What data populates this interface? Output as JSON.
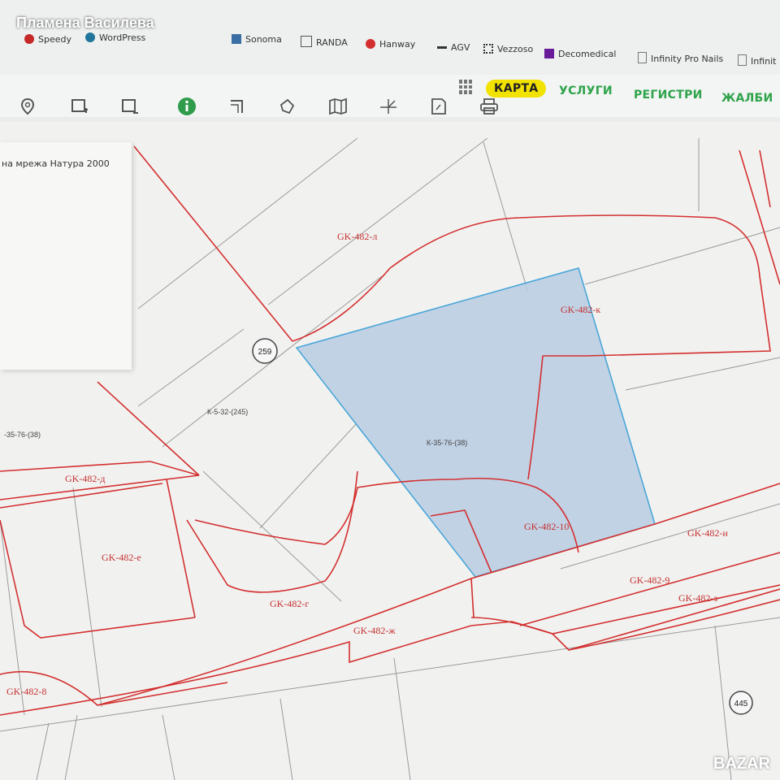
{
  "owner_name": "Пламена Василева",
  "bookmarks": [
    {
      "label": "Speedy",
      "icon": "speedy-icon",
      "color": "#c62828"
    },
    {
      "label": "WordPress",
      "icon": "wordpress-icon",
      "color": "#21759b"
    },
    {
      "label": "Sonoma",
      "icon": "sonoma-icon",
      "color": "#3a6ea5"
    },
    {
      "label": "RANDA",
      "icon": "randa-icon",
      "color": "#555555"
    },
    {
      "label": "Hanway",
      "icon": "hanway-icon",
      "color": "#d32f2f"
    },
    {
      "label": "AGV",
      "icon": "agv-icon",
      "color": "#333333"
    },
    {
      "label": "Vezzoso",
      "icon": "vezzoso-icon",
      "color": "#333333"
    },
    {
      "label": "Decomedical",
      "icon": "decomedical-icon",
      "color": "#6a1b9a"
    },
    {
      "label": "Infinity Pro Nails",
      "icon": "page-icon",
      "color": "#777777"
    },
    {
      "label": "Infinit",
      "icon": "page-icon",
      "color": "#777777"
    }
  ],
  "nav": {
    "apps_icon": "grid-icon",
    "items": [
      {
        "label": "КАРТА",
        "active": true
      },
      {
        "label": "УСЛУГИ",
        "active": false
      },
      {
        "label": "РЕГИСТРИ",
        "active": false
      },
      {
        "label": "ЖАЛБИ",
        "active": false
      }
    ]
  },
  "toolbar": [
    {
      "icon": "location-pin-icon"
    },
    {
      "icon": "draw-rectangle-icon"
    },
    {
      "icon": "select-rectangle-icon"
    },
    {
      "icon": "info-icon",
      "active": true
    },
    {
      "icon": "measure-line-icon"
    },
    {
      "icon": "polygon-icon"
    },
    {
      "icon": "map-layers-icon"
    },
    {
      "icon": "measure-angle-icon"
    },
    {
      "icon": "document-icon"
    },
    {
      "icon": "print-icon"
    }
  ],
  "panel": {
    "text": "на мрежа Натура 2000"
  },
  "map": {
    "boundary_color": "#d32f2f",
    "highlight_fill": "#b9cde3",
    "highlight_stroke": "#4aa6d8",
    "labels": [
      "GK-482-л",
      "GK-482-к",
      "GK-482-д",
      "GK-482-е",
      "GK-482-г",
      "GK-482-ж",
      "GK-482-8",
      "GK-482-10",
      "GK-482-и",
      "GK-482-9",
      "GK-482-з"
    ],
    "parcel_labels": [
      "К-5-32-(245)",
      "-35-76-(38)",
      "К-35-76-(38)"
    ],
    "road_markers": [
      "259",
      "445"
    ]
  },
  "watermark": "BAZAR"
}
